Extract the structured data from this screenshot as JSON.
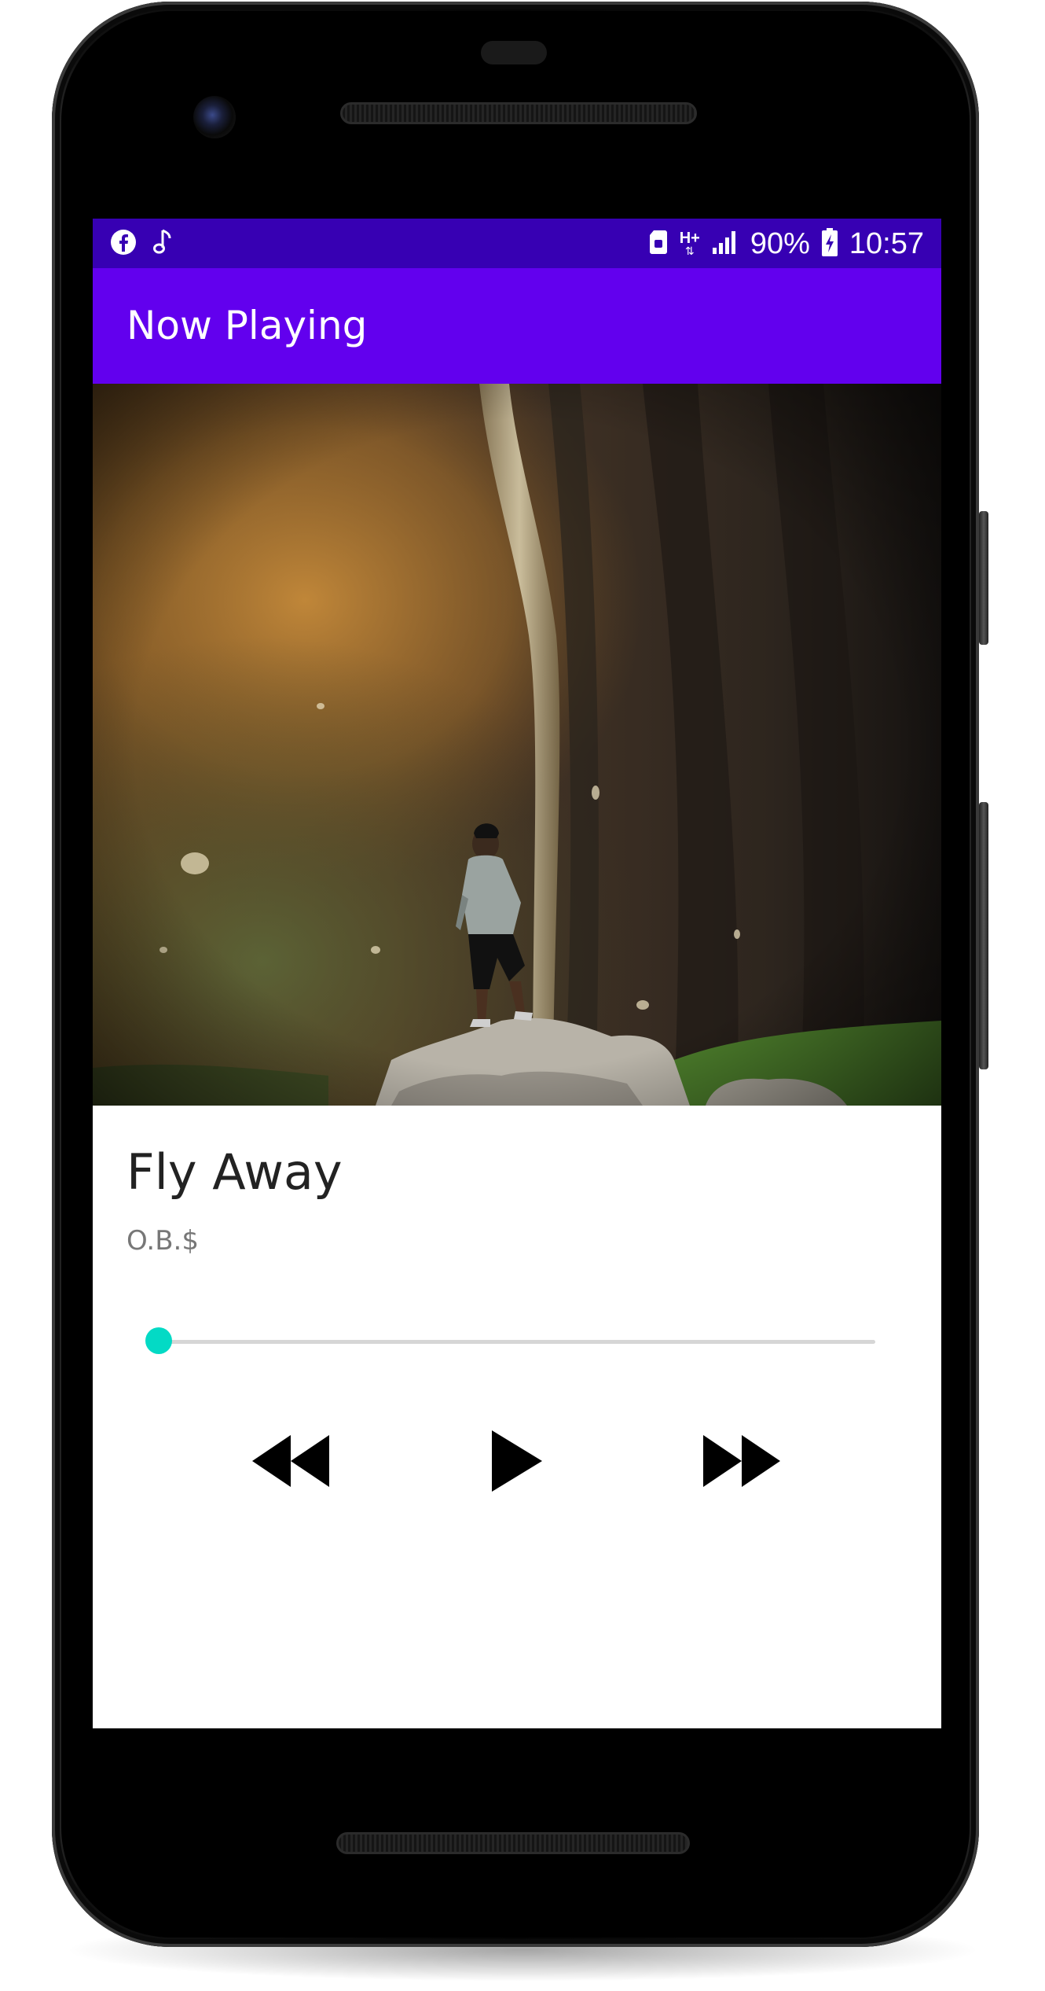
{
  "status_bar": {
    "battery_percent": "90%",
    "time": "10:57",
    "network_label": "H+",
    "left_icons": [
      "facebook-icon",
      "music-note-icon"
    ],
    "right_icons": [
      "sim-icon",
      "network-h-plus-icon",
      "signal-icon",
      "battery-charging-icon"
    ],
    "background": "#3700b3"
  },
  "app_bar": {
    "title": "Now Playing",
    "background": "#6200ee"
  },
  "track": {
    "title": "Fly Away",
    "artist": "O.B.$",
    "progress": 0.0
  },
  "controls": {
    "icons": [
      "rewind-icon",
      "play-icon",
      "fast-forward-icon"
    ]
  },
  "colors": {
    "accent": "#03dac5",
    "primary": "#6200ee",
    "primary_dark": "#3700b3"
  }
}
